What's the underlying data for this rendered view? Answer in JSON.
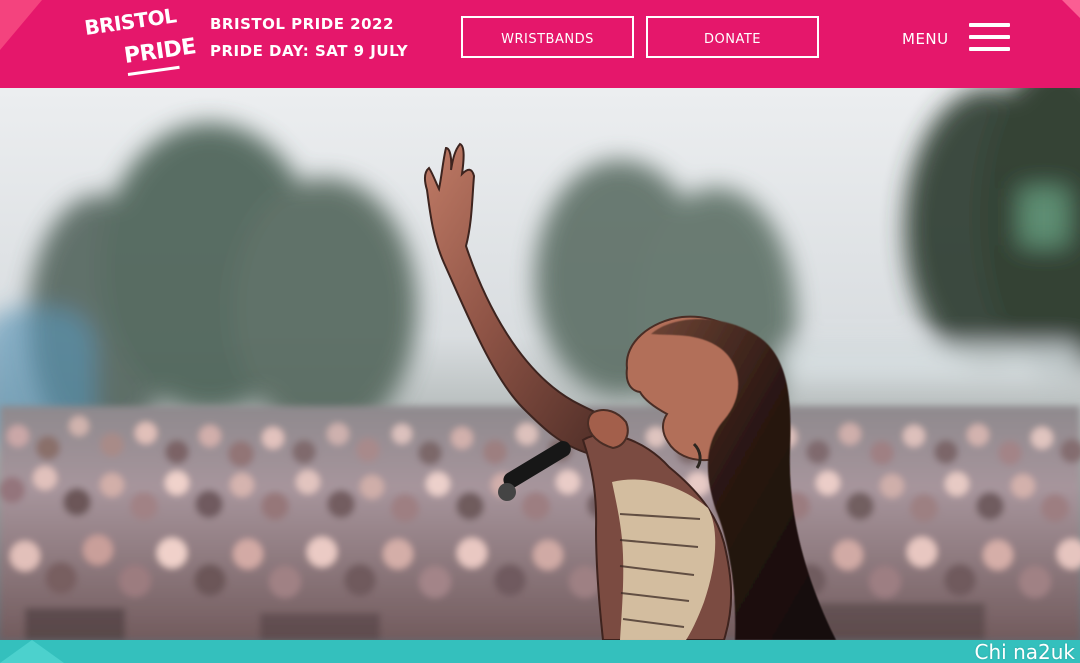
{
  "header": {
    "logo": {
      "line_one": "BRISTOL",
      "line_two": "PRIDE"
    },
    "festival_title": "BRISTOL PRIDE 2022",
    "festival_date": "PRIDE DAY: SAT 9 JULY",
    "buttons": [
      {
        "label": "WRISTBANDS"
      },
      {
        "label": "DONATE"
      }
    ],
    "menu_label": "MENU",
    "menu_icon": "hamburger-menu-icon"
  },
  "hero": {
    "image_alt": "Performer on stage raising one arm above a festival crowd"
  },
  "footer_strip": {
    "watermark": "Chi na2uk"
  },
  "colors": {
    "brand_pink": "#e5176b",
    "accent_teal": "#34c0bd",
    "text_white": "#ffffff"
  }
}
